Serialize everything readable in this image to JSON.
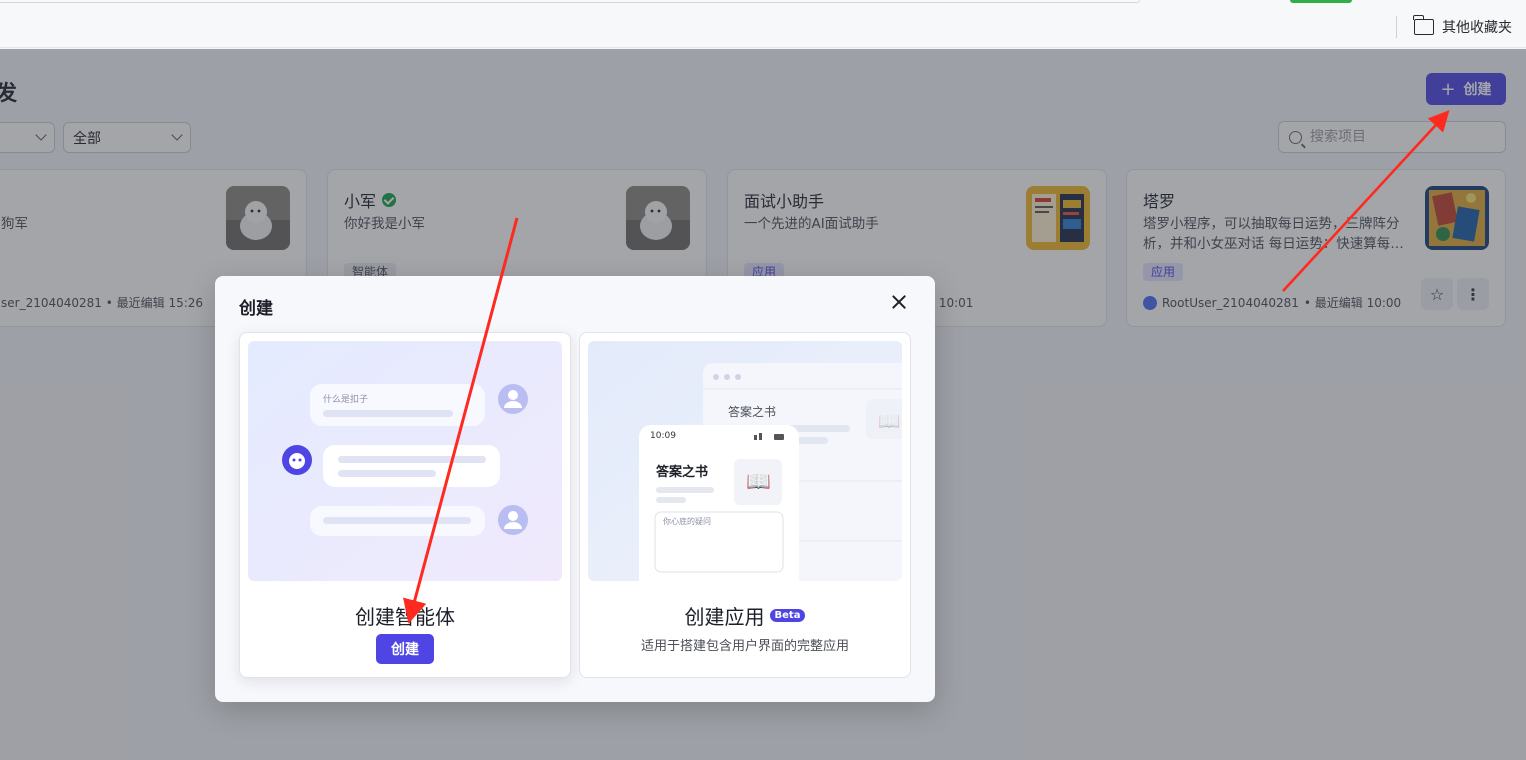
{
  "browser": {
    "bookmarks_folder": "其他收藏夹"
  },
  "header": {
    "title": "发",
    "create_label": "创建"
  },
  "filters": {
    "select_2": "全部",
    "search_placeholder": "搜索项目"
  },
  "cards": [
    {
      "desc": "狗军",
      "meta": "ser_2104040281 • 最近编辑 15:26"
    },
    {
      "name": "小军",
      "desc": "你好我是小军",
      "tag": "智能体"
    },
    {
      "name": "面试小助手",
      "desc": "一个先进的AI面试助手",
      "tag": "应用",
      "meta": "辑 10:01"
    },
    {
      "name": "塔罗",
      "desc": "塔罗小程序，可以抽取每日运势，三牌阵分析，并和小女巫对话 每日运势：快速算每…",
      "tag": "应用",
      "owner": "RootUser_2104040281",
      "meta": "• 最近编辑 10:00"
    }
  ],
  "modal": {
    "title": "创建",
    "agent": {
      "title": "创建智能体",
      "button": "创建",
      "bubble_text": "什么是扣子"
    },
    "app": {
      "title": "创建应用",
      "badge": "Beta",
      "subtitle": "适用于搭建包含用户界面的完整应用",
      "phone_time": "10:09",
      "app_name": "答案之书",
      "input_placeholder": "你心底的疑问"
    }
  },
  "colors": {
    "accent": "#4E45E4",
    "annotation_arrow": "#FF2A1F",
    "verified": "#16A34A"
  }
}
